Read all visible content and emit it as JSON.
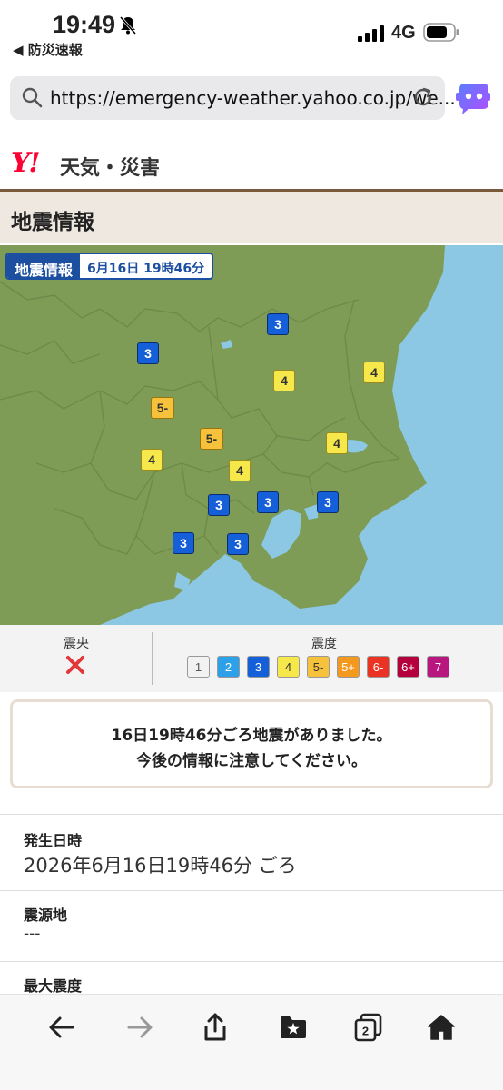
{
  "status_bar": {
    "time": "19:49",
    "back_app": "◀ 防災速報",
    "network": "4G"
  },
  "url_bar": {
    "url": "https://emergency-weather.yahoo.co.jp/we..."
  },
  "site": {
    "logo": "Y!",
    "title": "天気・災害"
  },
  "page_title": "地震情報",
  "map": {
    "label": "地震情報",
    "datetime": "6月16日 19時46分",
    "markers": [
      {
        "value": "3",
        "level": "3"
      },
      {
        "value": "3",
        "level": "3"
      },
      {
        "value": "4",
        "level": "4"
      },
      {
        "value": "4",
        "level": "4"
      },
      {
        "value": "5-",
        "level": "5-"
      },
      {
        "value": "5-",
        "level": "5-"
      },
      {
        "value": "4",
        "level": "4"
      },
      {
        "value": "4",
        "level": "4"
      },
      {
        "value": "4",
        "level": "4"
      },
      {
        "value": "3",
        "level": "3"
      },
      {
        "value": "3",
        "level": "3"
      },
      {
        "value": "3",
        "level": "3"
      },
      {
        "value": "3",
        "level": "3"
      },
      {
        "value": "3",
        "level": "3"
      }
    ]
  },
  "legend": {
    "epicenter_title": "震央",
    "intensity_title": "震度",
    "scale": [
      {
        "label": "1",
        "bg": "#f2f2f2",
        "fg": "#555"
      },
      {
        "label": "2",
        "bg": "#2ca0e8",
        "fg": "#fff"
      },
      {
        "label": "3",
        "bg": "#1560d9",
        "fg": "#fff"
      },
      {
        "label": "4",
        "bg": "#f6e84b",
        "fg": "#333"
      },
      {
        "label": "5-",
        "bg": "#f6c23b",
        "fg": "#333"
      },
      {
        "label": "5+",
        "bg": "#f39a1e",
        "fg": "#fff"
      },
      {
        "label": "6-",
        "bg": "#ea3323",
        "fg": "#fff"
      },
      {
        "label": "6+",
        "bg": "#b4003c",
        "fg": "#fff"
      },
      {
        "label": "7",
        "bg": "#b8177f",
        "fg": "#fff"
      }
    ]
  },
  "notice": {
    "line1": "16日19時46分ごろ地震がありました。",
    "line2": "今後の情報に注意してください。"
  },
  "details": {
    "time_label": "発生日時",
    "time_value": "2026年6月16日19時46分 ごろ",
    "source_label": "震源地",
    "source_value": "---",
    "max_label": "最大震度"
  },
  "toolbar": {
    "tabs_count": "2"
  }
}
